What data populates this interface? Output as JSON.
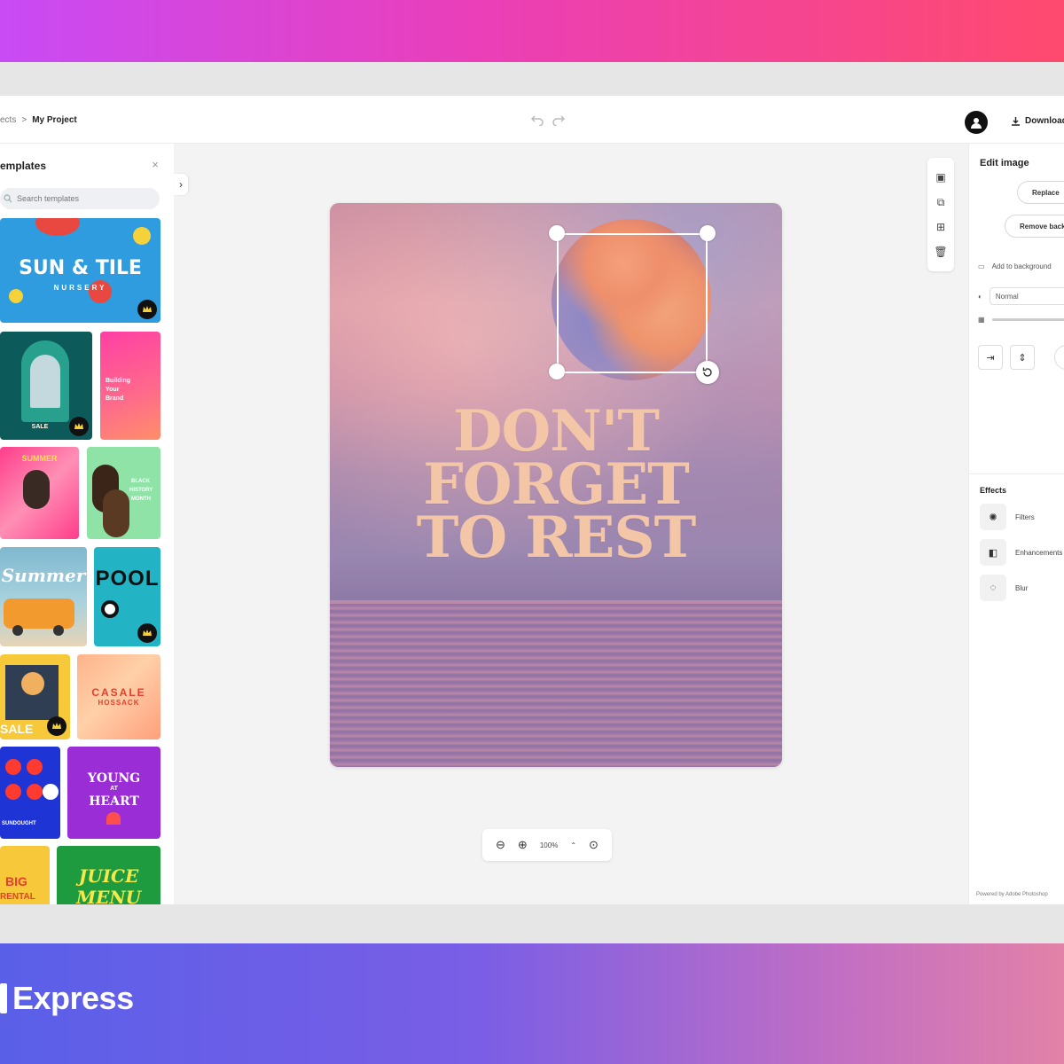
{
  "brand": {
    "name": "Express"
  },
  "header": {
    "breadcrumb_parent": "ects",
    "breadcrumb_sep": ">",
    "breadcrumb_current": "My Project",
    "download_label": "Download"
  },
  "left_panel": {
    "title": "emplates",
    "close_glyph": "×",
    "search_placeholder": "Search templates",
    "templates": [
      {
        "lines": [
          "SUN & TILE",
          "NURSERY"
        ],
        "premium": true
      },
      {
        "lines": [
          "SALE"
        ],
        "premium": true
      },
      {
        "lines": [
          "Building",
          "Your",
          "Brand"
        ],
        "premium": false
      },
      {
        "lines": [
          "SUMMER"
        ],
        "premium": false
      },
      {
        "lines": [
          "BLACK",
          "HISTORY",
          "MONTH"
        ],
        "premium": false
      },
      {
        "lines": [
          "Summer"
        ],
        "premium": false
      },
      {
        "lines": [
          "POOL"
        ],
        "premium": true
      },
      {
        "lines": [
          "SALE"
        ],
        "premium": true
      },
      {
        "lines": [
          "CASALE",
          "HOSSACK"
        ],
        "premium": false
      },
      {
        "lines": [
          "SUNDOUGHT"
        ],
        "premium": false
      },
      {
        "lines": [
          "YOUNG",
          "AT",
          "HEART"
        ],
        "premium": false
      },
      {
        "lines": [
          "BIG",
          "RENTAL"
        ],
        "premium": false
      },
      {
        "lines": [
          "JUICE",
          "MENU"
        ],
        "premium": false
      }
    ]
  },
  "canvas": {
    "headline_lines": [
      "DON'T",
      "FORGET",
      "TO REST"
    ],
    "zoom_label": "100%"
  },
  "right_panel": {
    "title": "Edit image",
    "replace_label": "Replace",
    "remove_bg_label": "Remove background",
    "add_to_background_label": "Add to background",
    "blend_mode": "Normal",
    "effects_label": "Effects",
    "effects": [
      "Filters",
      "Enhancements",
      "Blur"
    ],
    "powered_by": "Powered by Adobe Photoshop"
  },
  "colors": {
    "headline": "#f4c6a8",
    "top_gradient_start": "#c84bf5",
    "top_gradient_end": "#ff4a6e",
    "bottom_gradient_start": "#5a5fe8",
    "bottom_gradient_end": "#e282a7"
  }
}
